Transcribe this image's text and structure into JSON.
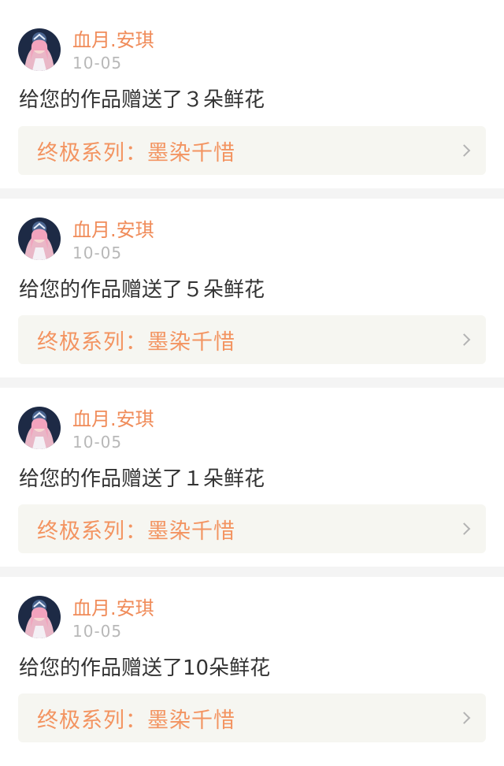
{
  "feed": {
    "items": [
      {
        "username": "血月.安琪",
        "date": "10-05",
        "message": "给您的作品赠送了３朵鲜花",
        "work_title": "终极系列：墨染千惜"
      },
      {
        "username": "血月.安琪",
        "date": "10-05",
        "message": "给您的作品赠送了５朵鲜花",
        "work_title": "终极系列：墨染千惜"
      },
      {
        "username": "血月.安琪",
        "date": "10-05",
        "message": "给您的作品赠送了１朵鲜花",
        "work_title": "终极系列：墨染千惜"
      },
      {
        "username": "血月.安琪",
        "date": "10-05",
        "message": "给您的作品赠送了10朵鲜花",
        "work_title": "终极系列：墨染千惜"
      }
    ]
  },
  "colors": {
    "accent": "#f08c5a",
    "tab_indicator": "#f07aa4",
    "link_background": "#f6f6f1"
  },
  "icons": {
    "avatar": "user-avatar-image",
    "chevron": "chevron-right-icon"
  }
}
